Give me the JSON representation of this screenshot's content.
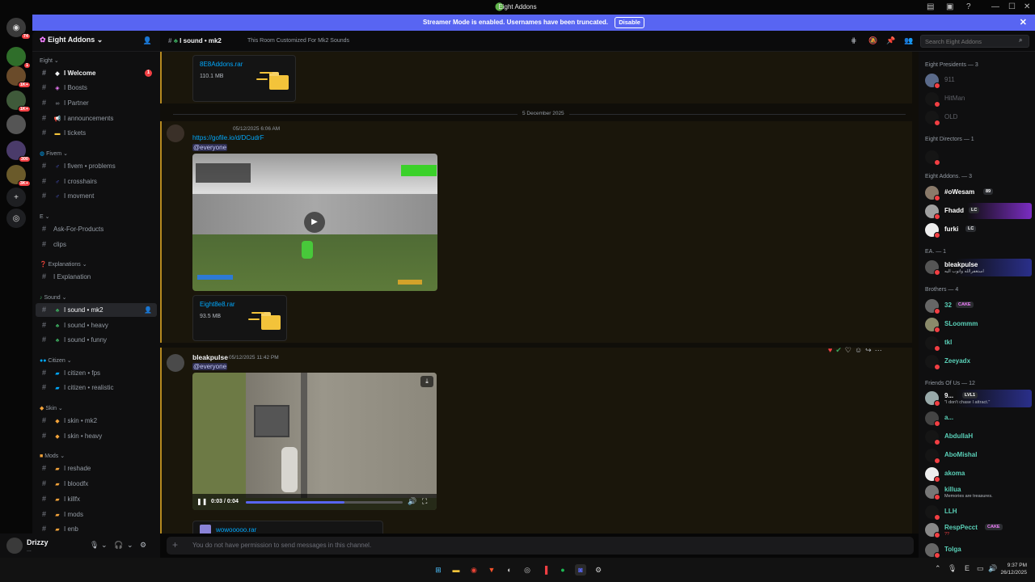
{
  "titlebar": {
    "title": "Eight Addons"
  },
  "banner": {
    "text": "Streamer Mode is enabled. Usernames have been truncated.",
    "disable_label": "Disable"
  },
  "server_badges": [
    "74",
    "1",
    "1K+",
    "1K+",
    "300",
    "3K+"
  ],
  "server": {
    "name": "Eight Addons"
  },
  "categories": {
    "eight": "Eight",
    "fivem": "Fivem",
    "e": "E",
    "explanations": "Explanations",
    "sound": "Sound",
    "citizen": "Citizen",
    "skin": "Skin",
    "mods": "Mods"
  },
  "channels": {
    "welcome": "I Welcome",
    "welcome_badge": "1",
    "boosts": "I Boosts",
    "partner": "I Partner",
    "announcements": "I announcements",
    "tickets": "I tickets",
    "fivem_problems": "I fivem • problems",
    "crosshairs": "I crosshairs",
    "movment": "I movment",
    "ask": "Ask-For-Products",
    "clips": "clips",
    "explanation": "I Explanation",
    "sound_mk2": "I sound • mk2",
    "sound_heavy": "I sound • heavy",
    "sound_funny": "I sound • funny",
    "citizen_fps": "I citizen • fps",
    "citizen_realistic": "I citizen • realistic",
    "skin_mk2": "I skin • mk2",
    "skin_heavy": "I skin • heavy",
    "reshade": "I reshade",
    "bloodfx": "I bloodfx",
    "killfx": "I killfx",
    "mods": "I mods",
    "enb": "I enb"
  },
  "user": {
    "name": "Drizzy",
    "status": "..."
  },
  "header": {
    "channel": "I sound • mk2",
    "topic": "This Room Customized For Mk2 Sounds",
    "search_placeholder": "Search Eight Addons"
  },
  "messages": {
    "file1": {
      "name": "8E8Addons.rar",
      "size": "110.1 MB"
    },
    "date_divider": "5 December 2025",
    "msg1": {
      "time": "05/12/2025 6:06 AM",
      "link": "https://gofile.io/d/DCudrF",
      "mention": "@everyone"
    },
    "file2": {
      "name": "Eight8e8.rar",
      "size": "93.5 MB"
    },
    "msg2": {
      "author": "bleakpulse",
      "time": "05/12/2025 11:42 PM",
      "mention": "@everyone",
      "video_time": "0:03 / 0:04",
      "video_progress": 0.63
    },
    "file3": {
      "name": "wowooooo.rar"
    }
  },
  "composer": {
    "placeholder": "You do not have permission to send messages in this channel."
  },
  "members": {
    "presidents": {
      "title": "Eight Presidents — 3",
      "items": [
        "911",
        "HitMan",
        "OLD"
      ]
    },
    "directors": {
      "title": "Eight Directors — 1"
    },
    "addons": {
      "title": "Eight Addons. — 3",
      "items": [
        {
          "name": "#oWesam",
          "tag": "89"
        },
        {
          "name": "Fhadd",
          "tag": "LC"
        },
        {
          "name": "furki",
          "tag": "LC"
        }
      ]
    },
    "ea": {
      "title": "EA. — 1",
      "items": [
        {
          "name": "bleakpulse",
          "status": "استغفرالله واتوب اليه"
        }
      ]
    },
    "brothers": {
      "title": "Brothers — 4",
      "items": [
        {
          "name": "32",
          "tag": "CAKE"
        },
        {
          "name": "SLoommm"
        },
        {
          "name": "tkl"
        },
        {
          "name": "Zeeyadx"
        }
      ]
    },
    "friends": {
      "title": "Friends Of Us — 12",
      "items": [
        {
          "name": "9...",
          "tag": "LVL1",
          "status": "\"I don't chase I attract.\""
        },
        {
          "name": "a..."
        },
        {
          "name": "AbdullaH"
        },
        {
          "name": "AboMishal"
        },
        {
          "name": "akoma"
        },
        {
          "name": "killua",
          "status": "Memories are treasures."
        },
        {
          "name": "LLH"
        },
        {
          "name": "RespPecct",
          "tag": "CAKE",
          "status": "??"
        },
        {
          "name": "Tolga"
        }
      ]
    }
  },
  "taskbar": {
    "lang": "E",
    "time": "9:37 PM",
    "date": "26/12/2025"
  },
  "colors": {
    "accent": "#5865f2",
    "highlight": "#b58a20",
    "link": "#00a8fc",
    "danger": "#f23f43"
  }
}
